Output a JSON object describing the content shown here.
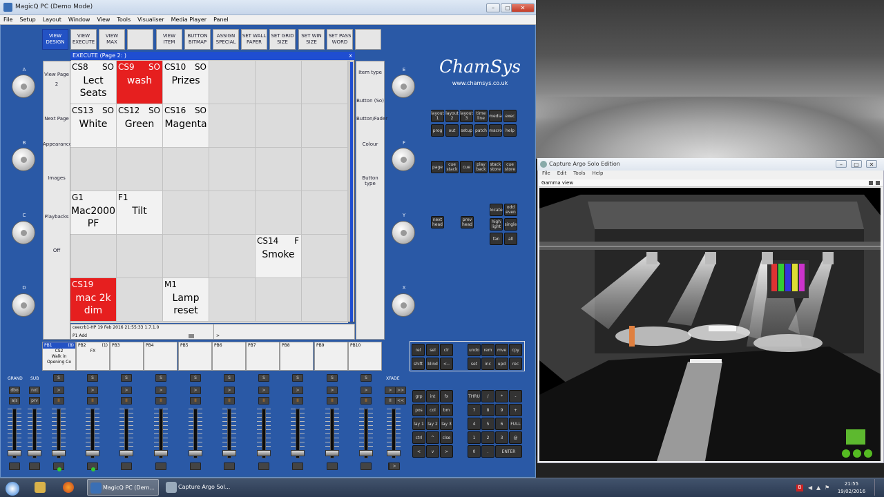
{
  "magicq": {
    "title": "MagicQ PC (Demo Mode)",
    "menu": [
      "File",
      "Setup",
      "Layout",
      "Window",
      "View",
      "Tools",
      "Visualiser",
      "Media Player",
      "Panel"
    ],
    "toolbar": [
      [
        "VIEW",
        "DESIGN"
      ],
      [
        "VIEW",
        "EXECUTE"
      ],
      [
        "VIEW",
        "MAX"
      ],
      [
        "",
        ""
      ],
      [
        "VIEW",
        "ITEM"
      ],
      [
        "BUTTON",
        "BITMAP"
      ],
      [
        "ASSIGN",
        "SPECIAL"
      ],
      [
        "SET WALL",
        "PAPER"
      ],
      [
        "SET GRID",
        "SIZE"
      ],
      [
        "SET WIN",
        "SIZE"
      ],
      [
        "SET PASS",
        "WORD"
      ],
      [
        "",
        ""
      ]
    ],
    "left_panel": {
      "view_page": "View Page",
      "page_num": "2",
      "next_page": "Next Page",
      "appearance": "Appearance",
      "images": "Images",
      "playbacks": "Playbacks",
      "off": "Off"
    },
    "right_panel": {
      "item_type": "Item type",
      "button_so": "Button (So)",
      "button_fader": "Button/Fader",
      "colour": "Colour",
      "button_type": "Button type"
    },
    "knobs": {
      "left": [
        "A",
        "B",
        "C",
        "D"
      ],
      "right": [
        "E",
        "F",
        "Y",
        "X"
      ]
    },
    "execute": {
      "title": "EXECUTE (Page 2: )",
      "close": "x",
      "cells": [
        {
          "id": "CS8",
          "tag": "SO",
          "name": "Lect\nSeats",
          "state": "on"
        },
        {
          "id": "CS9",
          "tag": "SO",
          "name": "wash",
          "state": "red"
        },
        {
          "id": "CS10",
          "tag": "SO",
          "name": "Prizes",
          "state": "on"
        },
        {},
        {},
        {},
        {
          "id": "CS13",
          "tag": "SO",
          "name": "White",
          "state": "on"
        },
        {
          "id": "CS12",
          "tag": "SO",
          "name": "Green",
          "state": "on"
        },
        {
          "id": "CS16",
          "tag": "SO",
          "name": "Magenta",
          "state": "on"
        },
        {},
        {},
        {},
        {},
        {},
        {},
        {},
        {},
        {},
        {
          "id": "G1",
          "tag": "",
          "name": "Mac2000\nPF",
          "state": "on"
        },
        {
          "id": "F1",
          "tag": "",
          "name": "Tilt",
          "state": "on"
        },
        {},
        {},
        {},
        {},
        {},
        {},
        {},
        {},
        {
          "id": "CS14",
          "tag": "F",
          "name": "Smoke",
          "state": "on"
        },
        {},
        {
          "id": "CS19",
          "tag": "",
          "name": "mac 2k\ndim",
          "state": "red"
        },
        {},
        {
          "id": "M1",
          "tag": "",
          "name": "Lamp\nreset",
          "state": "on"
        },
        {},
        {},
        {}
      ]
    },
    "status": {
      "line1": "ceecrb1-HP 19 Feb 2016 21:55:33 1.7.1.0",
      "line2": "P1 Add",
      "input": ">"
    },
    "playbacks": [
      {
        "id": "PB1",
        "extra": "(8)",
        "l1": "CS2",
        "l2": "Walk in",
        "l3": "Opening Co"
      },
      {
        "id": "PB2",
        "extra": "(1)",
        "l1": "FX",
        "l2": "",
        "l3": ""
      },
      {
        "id": "PB3",
        "extra": "",
        "l1": "",
        "l2": "",
        "l3": ""
      },
      {
        "id": "PB4",
        "extra": "",
        "l1": "",
        "l2": "",
        "l3": ""
      },
      {
        "id": "PB5",
        "extra": "",
        "l1": "",
        "l2": "",
        "l3": ""
      },
      {
        "id": "PB6",
        "extra": "",
        "l1": "",
        "l2": "",
        "l3": ""
      },
      {
        "id": "PB7",
        "extra": "",
        "l1": "",
        "l2": "",
        "l3": ""
      },
      {
        "id": "PB8",
        "extra": "",
        "l1": "",
        "l2": "",
        "l3": ""
      },
      {
        "id": "PB9",
        "extra": "",
        "l1": "",
        "l2": "",
        "l3": ""
      },
      {
        "id": "PB10",
        "extra": "",
        "l1": "",
        "l2": "",
        "l3": ""
      }
    ],
    "faders": {
      "grand": "GRAND",
      "sub": "SUB",
      "xfade": "XFADE",
      "grand_btns": [
        "dbo",
        "a/s"
      ],
      "sub_btns": [
        "nxt",
        "prv"
      ],
      "s": "S",
      "go": ">",
      "pause": "II",
      "xf_btns": [
        ">",
        ">>",
        "II",
        "<<"
      ],
      "xf_go": ">"
    },
    "logo": {
      "name": "ChamSys",
      "url": "www.chamsys.co.uk"
    },
    "keys": {
      "layout": [
        "layout 1",
        "layout 2",
        "layout 3",
        "time line",
        "media",
        "exec",
        "prog",
        "out",
        "setup",
        "patch",
        "macro",
        "help"
      ],
      "page": [
        "page",
        "cue stack",
        "cue",
        "play back",
        "stack store",
        "cue store"
      ],
      "head": [
        "next head",
        "prev head"
      ],
      "select": [
        "locate",
        "odd even",
        "high light",
        "single",
        "fan",
        "all"
      ],
      "edit": [
        "rel",
        "sel",
        "clr",
        "undo",
        "rem",
        "mve",
        "cpy",
        "shift",
        "blind",
        "<--",
        "set",
        "inc",
        "upd",
        "rec"
      ],
      "prog": [
        "grp",
        "int",
        "fx",
        "pos",
        "col",
        "bm",
        "lay 1",
        "lay 2",
        "lay 3",
        "ctrl",
        "^",
        "clse",
        "<",
        "v",
        ">"
      ],
      "numpad": [
        "THRU",
        "/",
        "*",
        "-",
        "7",
        "8",
        "9",
        "+",
        "4",
        "5",
        "6",
        "FULL",
        "1",
        "2",
        "3",
        "@",
        "0",
        ".",
        "ENTER"
      ]
    }
  },
  "argo": {
    "title": "Capture Argo Solo Edition",
    "menu": [
      "File",
      "Edit",
      "Tools",
      "Help"
    ],
    "view": "Gamma view"
  },
  "taskbar": {
    "tasks": [
      "MagicQ PC (Dem...",
      "Capture Argo Sol..."
    ],
    "time": "21:55",
    "date": "19/02/2016"
  }
}
